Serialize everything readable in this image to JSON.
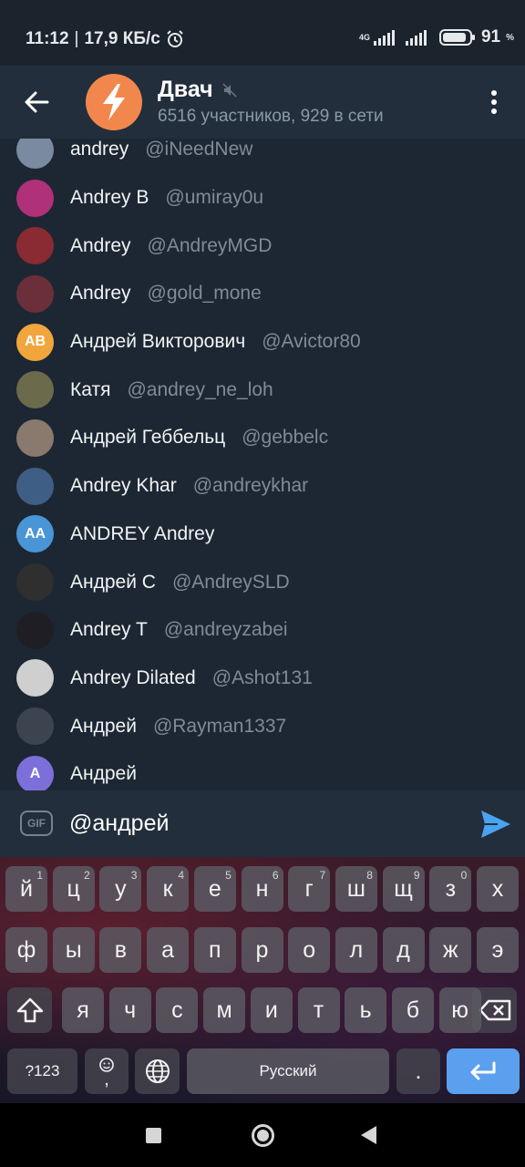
{
  "status": {
    "time": "11:12",
    "net_speed": "17,9 КБ/с",
    "net_tag": "4G",
    "battery": "91",
    "battery_level": 0.91
  },
  "header": {
    "title": "Двач",
    "subtitle": "6516 участников, 929 в сети"
  },
  "mentions": [
    {
      "name": "andrey",
      "username": "@iNeedNew",
      "initials": "",
      "color": "#7a8aa0"
    },
    {
      "name": "Andrey B",
      "username": "@umiray0u",
      "initials": "",
      "color": "#b0307a"
    },
    {
      "name": "Andrey",
      "username": "@AndreyMGD",
      "initials": "",
      "color": "#8a2a33"
    },
    {
      "name": "Andrey",
      "username": "@gold_mone",
      "initials": "",
      "color": "#6a2f3a"
    },
    {
      "name": "Андрей Викторович",
      "username": "@Avictor80",
      "initials": "АВ",
      "color": "#f0a63d"
    },
    {
      "name": "Катя",
      "username": "@andrey_ne_loh",
      "initials": "",
      "color": "#6b6a4a"
    },
    {
      "name": "Андрей Геббельц",
      "username": "@gebbelc",
      "initials": "",
      "color": "#8a7a6e"
    },
    {
      "name": "Andrey Khar",
      "username": "@andreykhar",
      "initials": "",
      "color": "#3e5e86"
    },
    {
      "name": "ANDREY Andrey",
      "username": "",
      "initials": "AA",
      "color": "#4a95d6"
    },
    {
      "name": "Андрей С",
      "username": "@AndreySLD",
      "initials": "",
      "color": "#2f2f2f"
    },
    {
      "name": "Andrey T",
      "username": "@andreyzabei",
      "initials": "",
      "color": "#1e1e24"
    },
    {
      "name": "Andrey Dilated",
      "username": "@Ashot131",
      "initials": "",
      "color": "#cfcfcf"
    },
    {
      "name": "Андрей",
      "username": "@Rayman1337",
      "initials": "",
      "color": "#3c4450"
    },
    {
      "name": "Андрей",
      "username": "",
      "initials": "А",
      "color": "#7d6fd9"
    }
  ],
  "input": {
    "gif_label": "GIF",
    "value": "@андрей"
  },
  "keyboard": {
    "row1": [
      {
        "k": "й",
        "s": "1"
      },
      {
        "k": "ц",
        "s": "2"
      },
      {
        "k": "у",
        "s": "3"
      },
      {
        "k": "к",
        "s": "4"
      },
      {
        "k": "е",
        "s": "5"
      },
      {
        "k": "н",
        "s": "6"
      },
      {
        "k": "г",
        "s": "7"
      },
      {
        "k": "ш",
        "s": "8"
      },
      {
        "k": "щ",
        "s": "9"
      },
      {
        "k": "з",
        "s": "0"
      },
      {
        "k": "х",
        "s": ""
      }
    ],
    "row2": [
      "ф",
      "ы",
      "в",
      "а",
      "п",
      "р",
      "о",
      "л",
      "д",
      "ж",
      "э"
    ],
    "row3": [
      "я",
      "ч",
      "с",
      "м",
      "и",
      "т",
      "ь",
      "б",
      "ю"
    ],
    "symbols_label": "?123",
    "comma_label": ",",
    "space_label": "Русский",
    "period_label": "."
  },
  "colors": {
    "header_bg": "#222e3b",
    "list_bg": "#1d2733",
    "accent": "#4aa3f0",
    "chat_avatar": "#f2874d"
  }
}
